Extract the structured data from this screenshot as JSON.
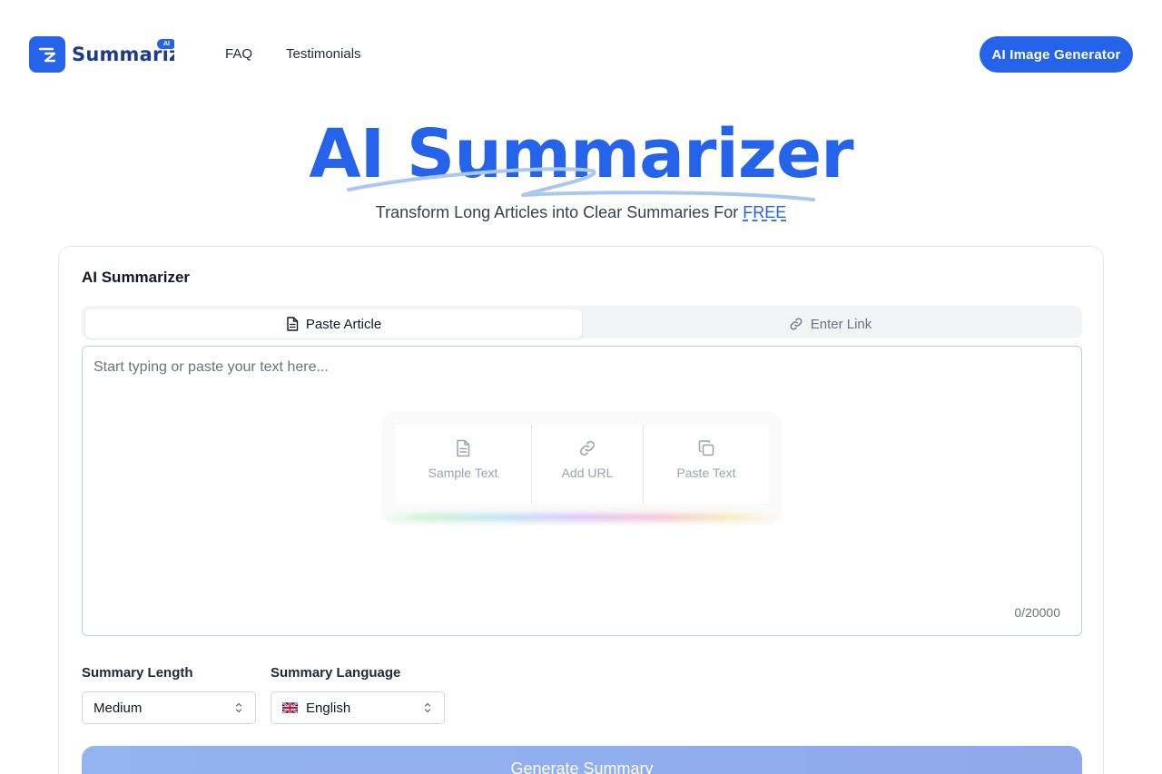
{
  "header": {
    "logo_text": "Summarizer",
    "logo_badge": "AI",
    "nav": [
      {
        "label": "FAQ"
      },
      {
        "label": "Testimonials"
      }
    ],
    "cta_label": "AI Image Generator"
  },
  "hero": {
    "title": "AI Summarizer",
    "subtitle": "Transform Long Articles into Clear Summaries For",
    "subtitle_highlight": "FREE"
  },
  "tool": {
    "title": "AI Summarizer",
    "tabs": [
      {
        "label": "Paste Article",
        "icon": "document-icon",
        "active": true
      },
      {
        "label": "Enter Link",
        "icon": "link-icon",
        "active": false
      }
    ],
    "textarea": {
      "placeholder": "Start typing or paste your text here...",
      "value": "",
      "counter": "0/20000"
    },
    "quick_actions": [
      {
        "label": "Sample Text",
        "icon": "document-icon"
      },
      {
        "label": "Add URL",
        "icon": "link-icon"
      },
      {
        "label": "Paste Text",
        "icon": "copy-icon"
      }
    ],
    "length": {
      "label": "Summary Length",
      "value": "Medium"
    },
    "language": {
      "label": "Summary Language",
      "value": "English",
      "flag": "uk-flag-icon"
    },
    "generate_label": "Generate Summary"
  },
  "colors": {
    "primary": "#2563eb",
    "logo_text": "#1e3a8a",
    "generate_disabled": "#93b4ef"
  }
}
